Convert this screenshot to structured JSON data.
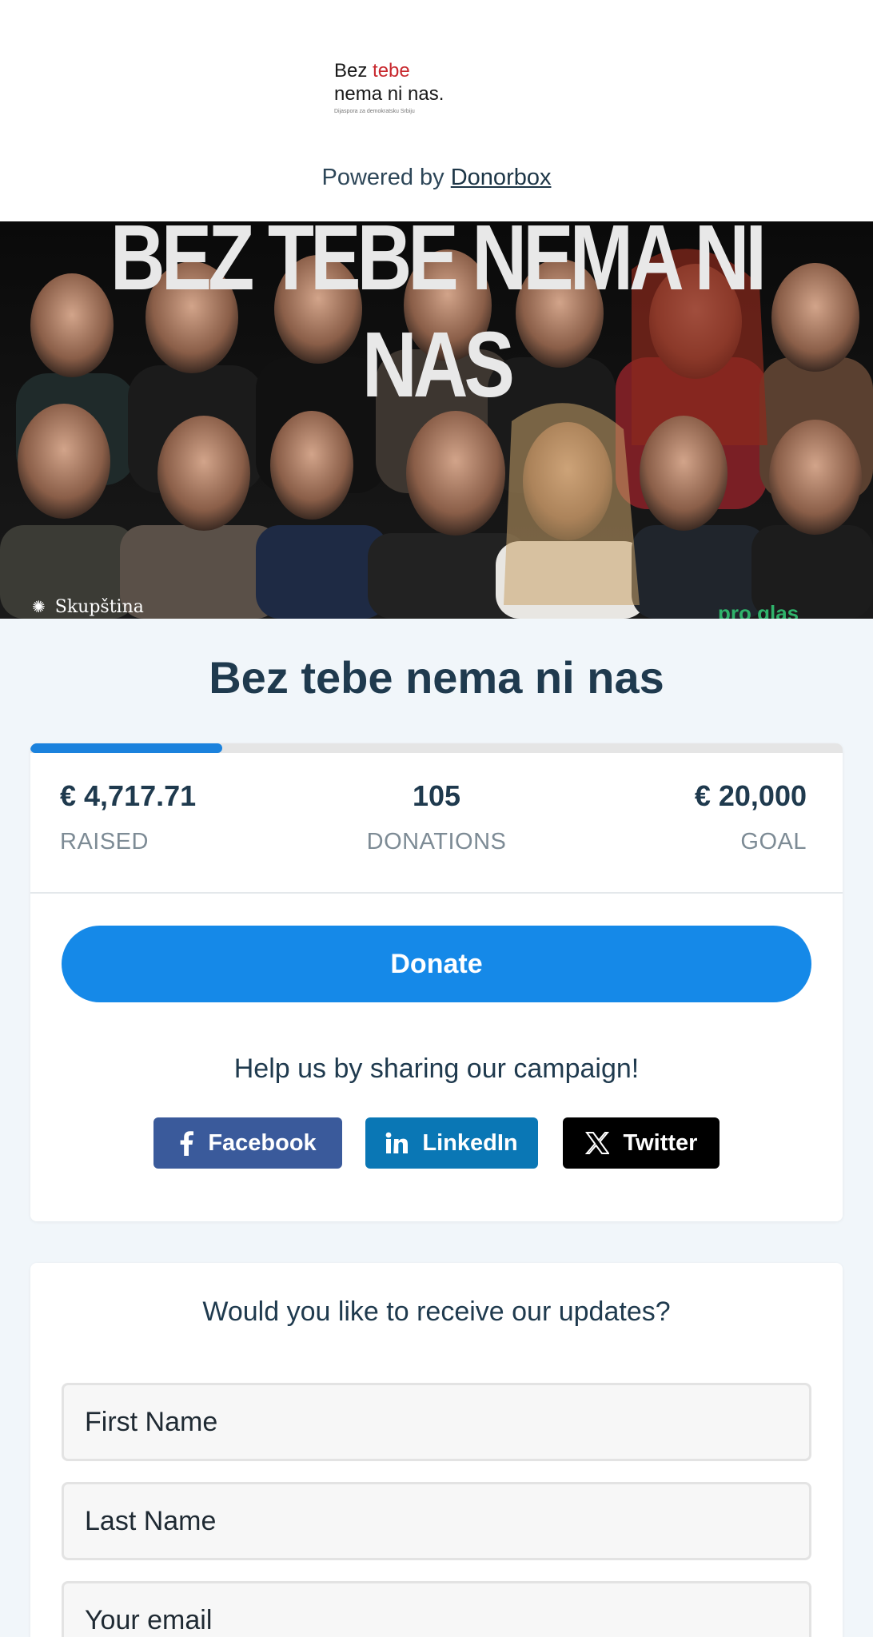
{
  "header": {
    "logo": {
      "line1_a": "Bez",
      "line1_b": "tebe",
      "line2": "nema ni nas.",
      "tagline": "Dijaspora za demokratsku Srbiju"
    },
    "powered_by_prefix": "Powered by",
    "powered_by_link": "Donorbox"
  },
  "hero": {
    "banner_text": "BEZ TEBE NEMA NI NAS",
    "footer_left": "Skupština",
    "footer_right": "pro glas"
  },
  "campaign": {
    "title": "Bez tebe nema ni nas",
    "progress_fraction": 0.236,
    "stats": {
      "raised_value": "€ 4,717.71",
      "raised_label": "RAISED",
      "donations_value": "105",
      "donations_label": "DONATIONS",
      "goal_value": "€ 20,000",
      "goal_label": "GOAL"
    },
    "donate_label": "Donate",
    "share_prompt": "Help us by sharing our campaign!",
    "share": {
      "facebook": "Facebook",
      "linkedin": "LinkedIn",
      "twitter": "Twitter"
    }
  },
  "updates": {
    "prompt": "Would you like to receive our updates?",
    "first_name_placeholder": "First Name",
    "last_name_placeholder": "Last Name",
    "email_placeholder": "Your email"
  },
  "colors": {
    "primary": "#1589e8",
    "progress": "#1b82dd",
    "facebook": "#3a5a9b",
    "linkedin": "#0a77b5",
    "twitter": "#000000",
    "heading": "#1f3a4e",
    "page_bg": "#f1f6fa"
  },
  "icons": [
    "facebook-icon",
    "linkedin-icon",
    "x-twitter-icon",
    "skupstina-logo-icon",
    "pro-glas-leaf-icon"
  ]
}
